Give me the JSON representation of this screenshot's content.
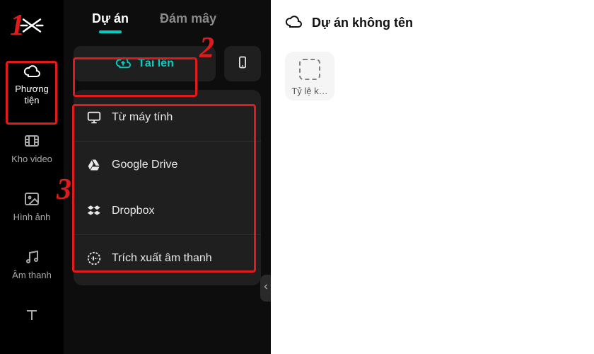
{
  "rail": {
    "items": [
      {
        "label": "Phương tiện",
        "active": true
      },
      {
        "label": "Kho video"
      },
      {
        "label": "Hình ảnh"
      },
      {
        "label": "Âm thanh"
      },
      {
        "label": ""
      }
    ]
  },
  "tabs": {
    "project": "Dự án",
    "cloud": "Đám mây"
  },
  "upload": {
    "button": "Tải lên",
    "menu": [
      "Từ máy tính",
      "Google Drive",
      "Dropbox",
      "Trích xuất âm thanh"
    ]
  },
  "right": {
    "title": "Dự án không tên",
    "aspect_label": "Tỷ lệ k…"
  },
  "colors": {
    "accent": "#00d0c2",
    "annotation": "#e11b1b"
  },
  "annotations": {
    "step1": "1",
    "step2": "2",
    "step3": "3"
  }
}
